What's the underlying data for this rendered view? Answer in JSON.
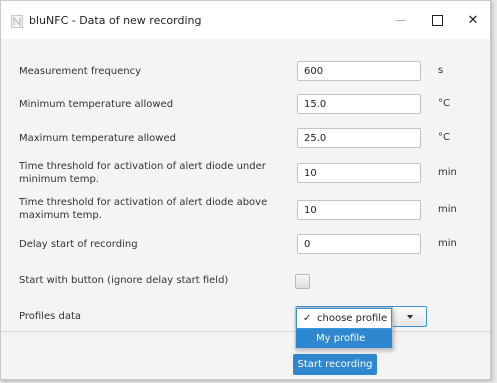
{
  "window": {
    "title": "bluNFC - Data of new recording",
    "icon": "nfc-app-icon",
    "controls": {
      "minimize": "minimize-icon",
      "maximize": "maximize-icon",
      "close": "✕"
    }
  },
  "fields": [
    {
      "label": "Measurement frequency",
      "value": "600",
      "unit": "s"
    },
    {
      "label": "Minimum temperature allowed",
      "value": "15.0",
      "unit": "°C"
    },
    {
      "label": "Maximum temperature allowed",
      "value": "25.0",
      "unit": "°C"
    },
    {
      "label": "Time threshold for activation of alert diode under minimum temp.",
      "value": "10",
      "unit": "min"
    },
    {
      "label": "Time threshold for activation of alert diode above maximum temp.",
      "value": "10",
      "unit": "min"
    },
    {
      "label": "Delay start of recording",
      "value": "0",
      "unit": "min"
    }
  ],
  "start_with_button": {
    "label": "Start with button (ignore delay start field)",
    "checked": false
  },
  "profiles": {
    "label": "Profiles data",
    "selected": "choose profile",
    "options": [
      "choose profile",
      "My profile"
    ],
    "check_glyph": "✓"
  },
  "actions": {
    "start_label": "Start recording"
  },
  "colors": {
    "accent": "#2e87cf",
    "background": "#f4f4f4"
  }
}
